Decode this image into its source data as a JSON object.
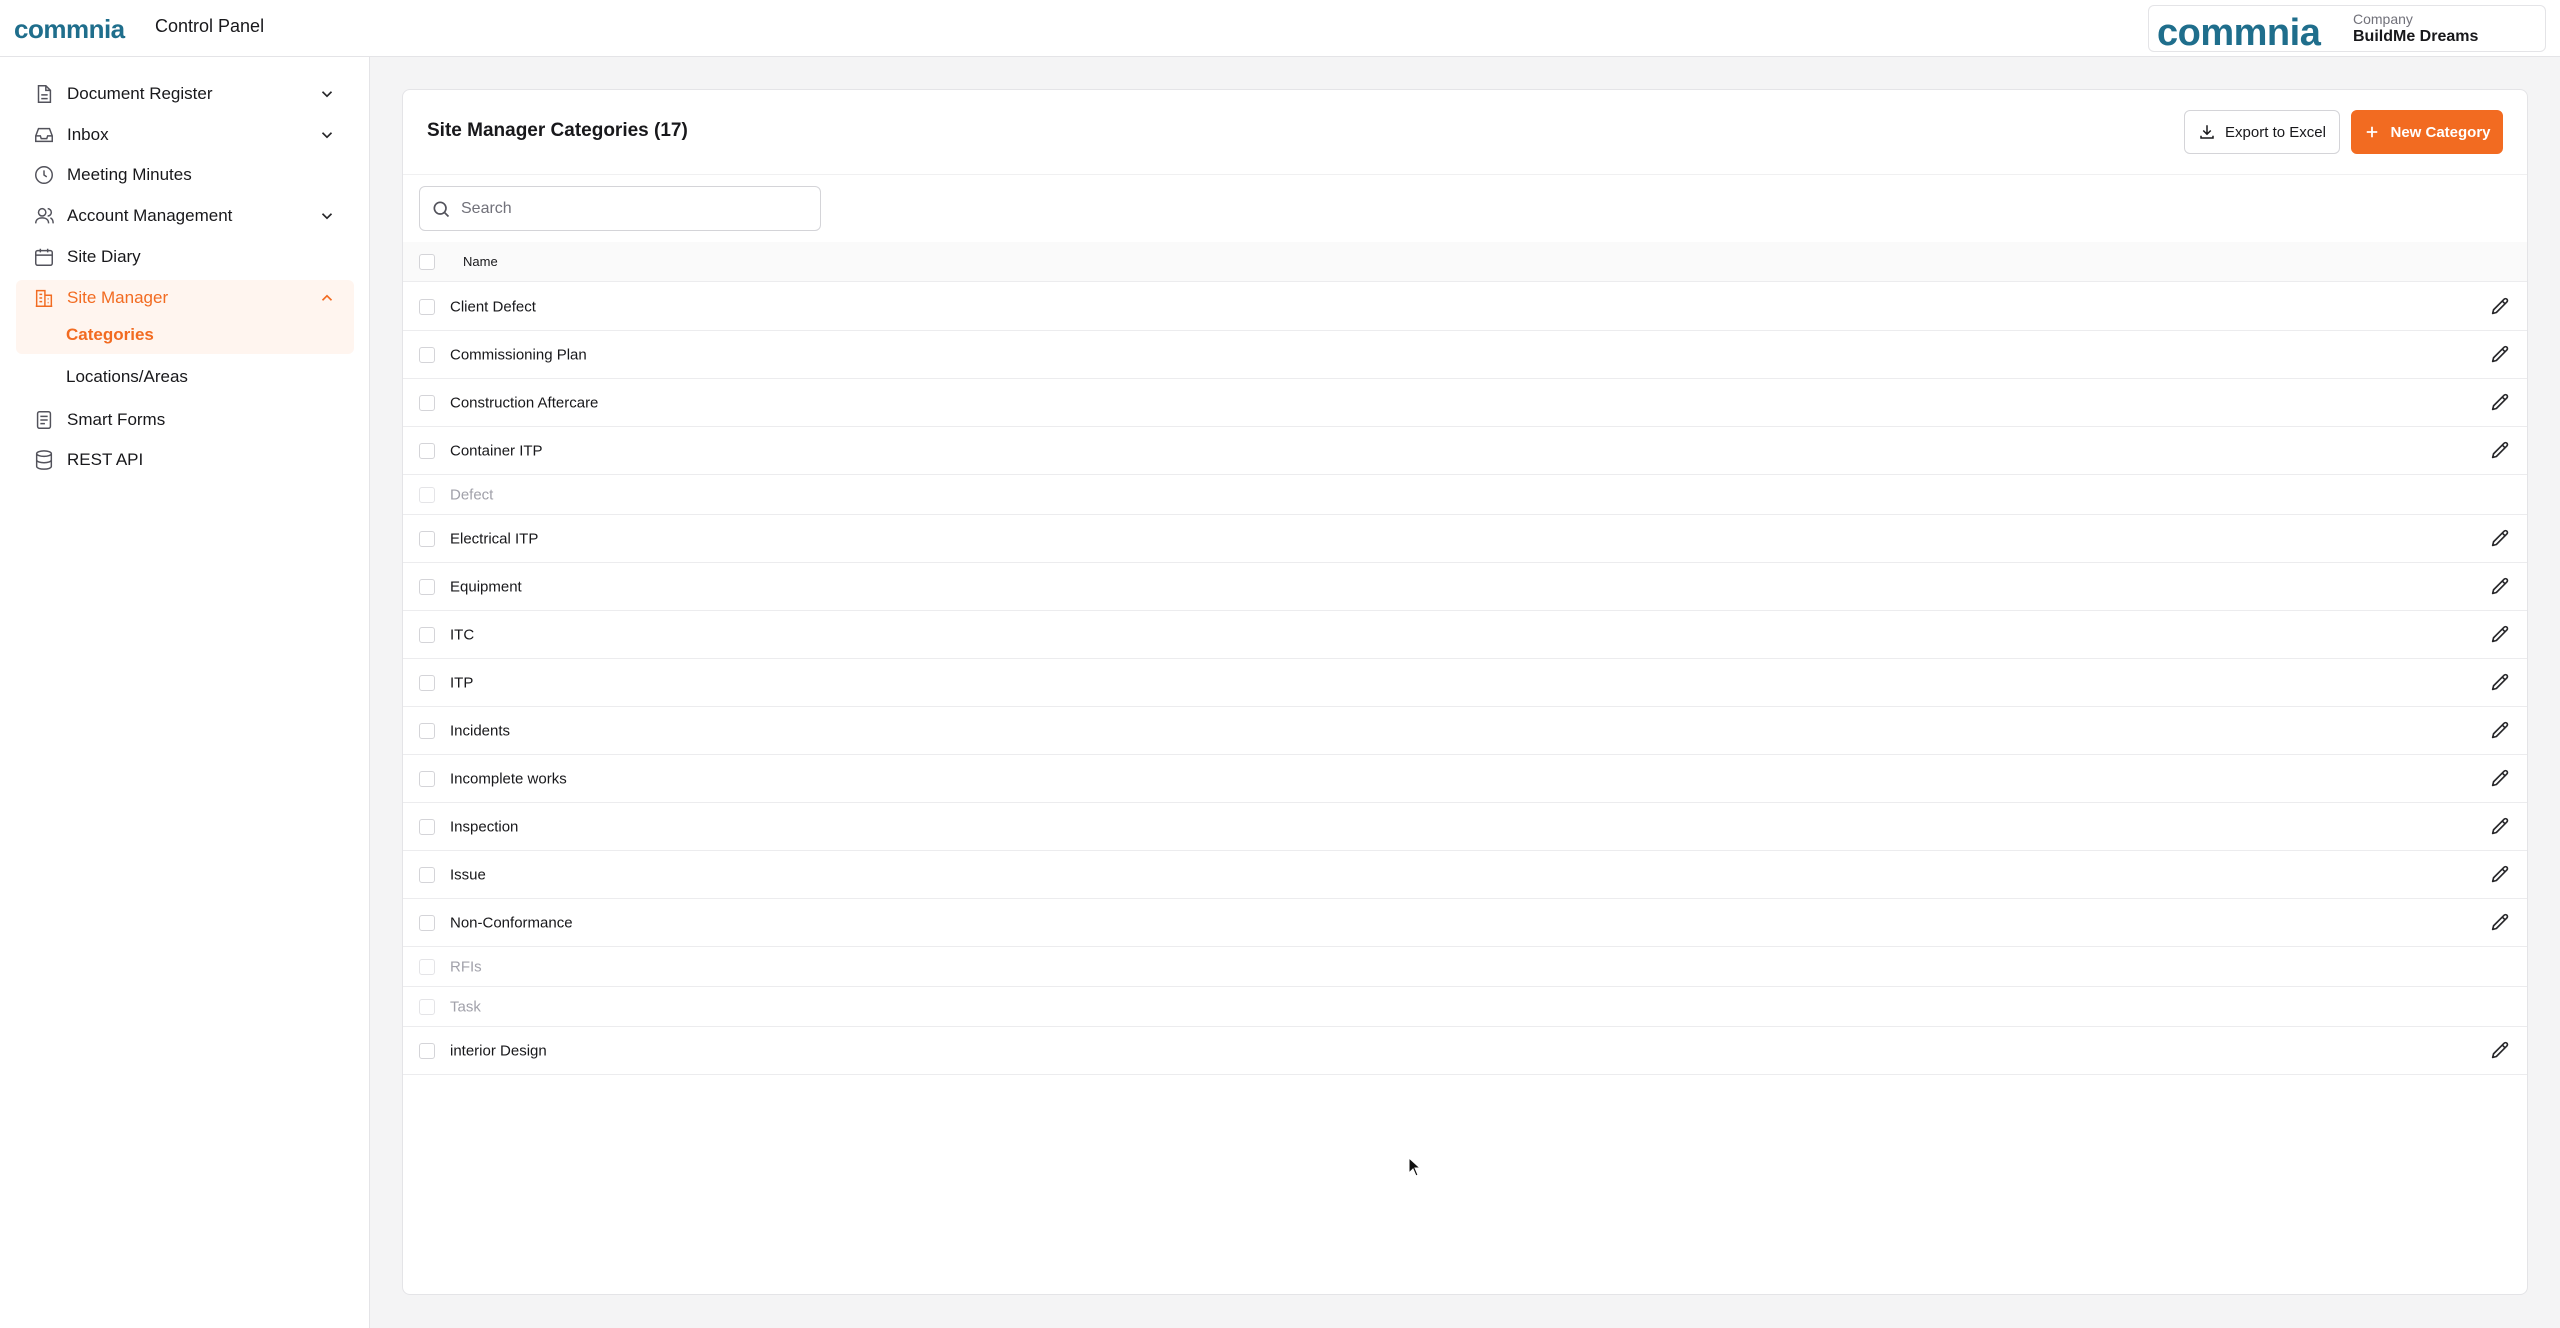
{
  "header": {
    "brand": "commnia",
    "title": "Control Panel",
    "company_label": "Company",
    "company_name": "BuildMe Dreams"
  },
  "colors": {
    "accent": "#f26b21",
    "brand_blue": "#1f6e8c",
    "text": "#18181b",
    "muted": "#a1a1aa"
  },
  "sidebar": {
    "items": [
      {
        "label": "Document Register",
        "icon": "document-icon",
        "expandable": true,
        "expanded": false
      },
      {
        "label": "Inbox",
        "icon": "inbox-icon",
        "expandable": true,
        "expanded": false
      },
      {
        "label": "Meeting Minutes",
        "icon": "clock-icon",
        "expandable": false
      },
      {
        "label": "Account Management",
        "icon": "users-icon",
        "expandable": true,
        "expanded": false
      },
      {
        "label": "Site Diary",
        "icon": "calendar-icon",
        "expandable": false
      },
      {
        "label": "Site Manager",
        "icon": "building-icon",
        "expandable": true,
        "expanded": true,
        "active": true,
        "children": [
          {
            "label": "Categories",
            "active": true
          },
          {
            "label": "Locations/Areas",
            "active": false
          }
        ]
      },
      {
        "label": "Smart Forms",
        "icon": "form-icon",
        "expandable": false
      },
      {
        "label": "REST API",
        "icon": "database-icon",
        "expandable": false
      }
    ]
  },
  "main": {
    "title": "Site Manager Categories (17)",
    "export_label": "Export to Excel",
    "new_label": "New Category",
    "search": {
      "placeholder": "Search",
      "value": ""
    },
    "columns": {
      "name": "Name"
    },
    "rows": [
      {
        "name": "Client Defect",
        "editable": true
      },
      {
        "name": "Commissioning Plan",
        "editable": true
      },
      {
        "name": "Construction Aftercare",
        "editable": true
      },
      {
        "name": "Container ITP",
        "editable": true
      },
      {
        "name": "Defect",
        "editable": false
      },
      {
        "name": "Electrical ITP",
        "editable": true
      },
      {
        "name": "Equipment",
        "editable": true
      },
      {
        "name": "ITC",
        "editable": true
      },
      {
        "name": "ITP",
        "editable": true
      },
      {
        "name": "Incidents",
        "editable": true
      },
      {
        "name": "Incomplete works",
        "editable": true
      },
      {
        "name": "Inspection",
        "editable": true
      },
      {
        "name": "Issue",
        "editable": true
      },
      {
        "name": "Non-Conformance",
        "editable": true
      },
      {
        "name": "RFIs",
        "editable": false
      },
      {
        "name": "Task",
        "editable": false
      },
      {
        "name": "interior Design",
        "editable": true
      }
    ]
  }
}
